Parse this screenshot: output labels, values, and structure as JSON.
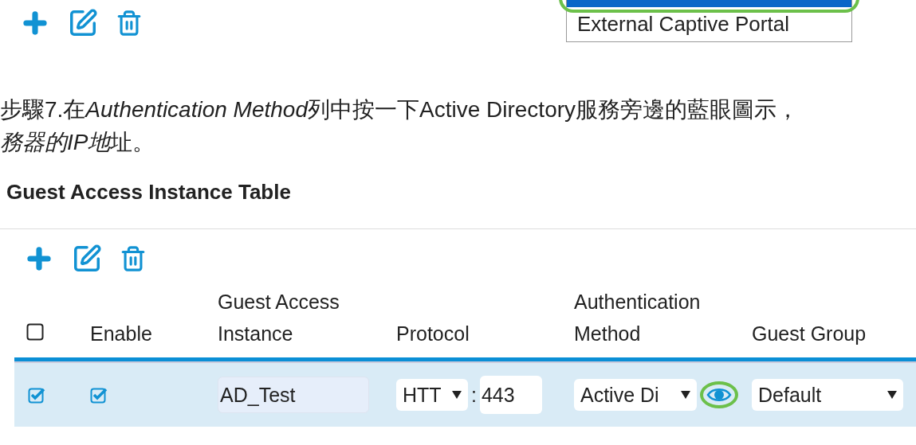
{
  "top_dropdown": {
    "options": [
      {
        "selected": true
      },
      {
        "label": "External Captive Portal",
        "selected": false
      }
    ]
  },
  "instruction": [
    [
      {
        "text": "步驟7.在",
        "italic": false
      },
      {
        "text": "Authentication Method",
        "italic": true
      },
      {
        "text": "列中按一下Active Directory服務旁邊的藍眼圖示，",
        "italic": false
      }
    ],
    [
      {
        "text": "務器的IP地",
        "italic": true
      },
      {
        "text": "址。",
        "italic": false
      }
    ]
  ],
  "section": {
    "title": "Guest Access Instance Table",
    "table": {
      "select_all_checked": false,
      "columns": [
        "Enable",
        "Guest Access Instance",
        "Protocol",
        "Authentication Method",
        "Guest Group"
      ],
      "rows": [
        {
          "selected": true,
          "checked": true,
          "enabled": true,
          "instance": "AD_Test",
          "protocol": "HTT",
          "port_separator": ":",
          "port": "443",
          "auth_method": "Active Di",
          "guest_group": "Default"
        }
      ]
    }
  }
}
